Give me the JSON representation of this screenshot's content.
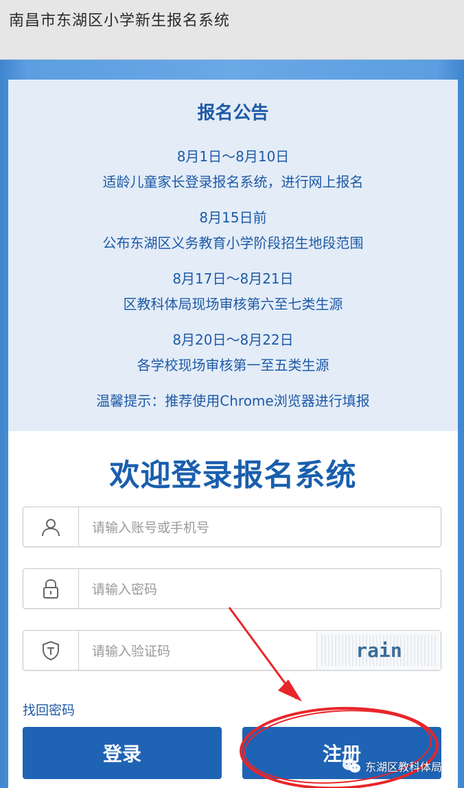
{
  "header": {
    "title": "南昌市东湖区小学新生报名系统"
  },
  "notice": {
    "heading": "报名公告",
    "items": [
      {
        "date": "8月1日～8月10日",
        "text": "适龄儿童家长登录报名系统，进行网上报名"
      },
      {
        "date": "8月15日前",
        "text": "公布东湖区义务教育小学阶段招生地段范围"
      },
      {
        "date": "8月17日～8月21日",
        "text": "区教科体局现场审核第六至七类生源"
      },
      {
        "date": "8月20日～8月22日",
        "text": "各学校现场审核第一至五类生源"
      }
    ],
    "tip": "温馨提示：推荐使用Chrome浏览器进行填报"
  },
  "login": {
    "welcome": "欢迎登录报名系统",
    "account_placeholder": "请输入账号或手机号",
    "password_placeholder": "请输入密码",
    "captcha_placeholder": "请输入验证码",
    "captcha_text": "rain",
    "forgot_label": "找回密码",
    "login_label": "登录",
    "register_label": "注册"
  },
  "watermark": {
    "text": "东湖区教科体局"
  },
  "icons": {
    "account": "user-icon",
    "password": "lock-icon",
    "captcha": "shield-icon",
    "watermark": "wechat-icon"
  },
  "colors": {
    "accent": "#1f63b4",
    "notice_bg": "#e3ecf7",
    "annotation": "#e8262a"
  }
}
